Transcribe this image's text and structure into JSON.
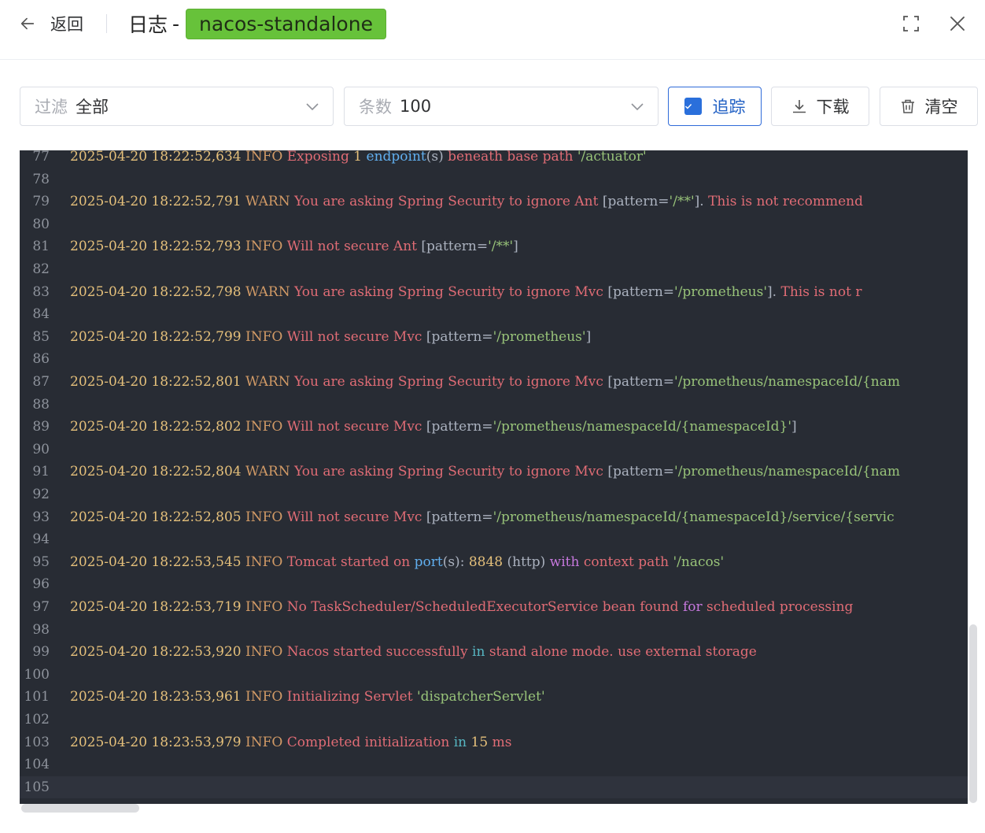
{
  "header": {
    "back_label": "返回",
    "title": "日志",
    "title_dash": "-",
    "app_tag": "nacos-standalone"
  },
  "toolbar": {
    "filter": {
      "prefix": "过滤",
      "value": "全部"
    },
    "count": {
      "prefix": "条数",
      "value": "100"
    },
    "track_label": "追踪",
    "download_label": "下载",
    "clear_label": "清空"
  },
  "colors": {
    "tag": "#67c23a",
    "accent": "#2a6fdb",
    "log_bg": "#282c34"
  },
  "log": {
    "lines": [
      {
        "n": "77",
        "segs": [
          [
            "ts",
            "2025-04-20 18:22:52,634 "
          ],
          [
            "lv",
            "INFO "
          ],
          [
            "w",
            "Exposing "
          ],
          [
            "num",
            "1 "
          ],
          [
            "kw",
            "endpoint"
          ],
          [
            "pun",
            "(s) "
          ],
          [
            "w",
            "beneath base path "
          ],
          [
            "str",
            "'/actuator'"
          ]
        ]
      },
      {
        "n": "78",
        "segs": []
      },
      {
        "n": "79",
        "segs": [
          [
            "ts",
            "2025-04-20 18:22:52,791 "
          ],
          [
            "lv",
            "WARN "
          ],
          [
            "w",
            "You are asking Spring Security to ignore Ant "
          ],
          [
            "pun",
            "[pattern="
          ],
          [
            "str",
            "'/**'"
          ],
          [
            "pun",
            "]. "
          ],
          [
            "w",
            "This is not recommend"
          ]
        ]
      },
      {
        "n": "80",
        "segs": []
      },
      {
        "n": "81",
        "segs": [
          [
            "ts",
            "2025-04-20 18:22:52,793 "
          ],
          [
            "lv",
            "INFO "
          ],
          [
            "w",
            "Will not secure Ant "
          ],
          [
            "pun",
            "[pattern="
          ],
          [
            "str",
            "'/**'"
          ],
          [
            "pun",
            "]"
          ]
        ]
      },
      {
        "n": "82",
        "segs": []
      },
      {
        "n": "83",
        "segs": [
          [
            "ts",
            "2025-04-20 18:22:52,798 "
          ],
          [
            "lv",
            "WARN "
          ],
          [
            "w",
            "You are asking Spring Security to ignore Mvc "
          ],
          [
            "pun",
            "[pattern="
          ],
          [
            "str",
            "'/prometheus'"
          ],
          [
            "pun",
            "]. "
          ],
          [
            "w",
            "This is not r"
          ]
        ]
      },
      {
        "n": "84",
        "segs": []
      },
      {
        "n": "85",
        "segs": [
          [
            "ts",
            "2025-04-20 18:22:52,799 "
          ],
          [
            "lv",
            "INFO "
          ],
          [
            "w",
            "Will not secure Mvc "
          ],
          [
            "pun",
            "[pattern="
          ],
          [
            "str",
            "'/prometheus'"
          ],
          [
            "pun",
            "]"
          ]
        ]
      },
      {
        "n": "86",
        "segs": []
      },
      {
        "n": "87",
        "segs": [
          [
            "ts",
            "2025-04-20 18:22:52,801 "
          ],
          [
            "lv",
            "WARN "
          ],
          [
            "w",
            "You are asking Spring Security to ignore Mvc "
          ],
          [
            "pun",
            "[pattern="
          ],
          [
            "str",
            "'/prometheus/namespaceId/{nam"
          ]
        ]
      },
      {
        "n": "88",
        "segs": []
      },
      {
        "n": "89",
        "segs": [
          [
            "ts",
            "2025-04-20 18:22:52,802 "
          ],
          [
            "lv",
            "INFO "
          ],
          [
            "w",
            "Will not secure Mvc "
          ],
          [
            "pun",
            "[pattern="
          ],
          [
            "str",
            "'/prometheus/namespaceId/{namespaceId}'"
          ],
          [
            "pun",
            "]"
          ]
        ]
      },
      {
        "n": "90",
        "segs": []
      },
      {
        "n": "91",
        "segs": [
          [
            "ts",
            "2025-04-20 18:22:52,804 "
          ],
          [
            "lv",
            "WARN "
          ],
          [
            "w",
            "You are asking Spring Security to ignore Mvc "
          ],
          [
            "pun",
            "[pattern="
          ],
          [
            "str",
            "'/prometheus/namespaceId/{nam"
          ]
        ]
      },
      {
        "n": "92",
        "segs": []
      },
      {
        "n": "93",
        "segs": [
          [
            "ts",
            "2025-04-20 18:22:52,805 "
          ],
          [
            "lv",
            "INFO "
          ],
          [
            "w",
            "Will not secure Mvc "
          ],
          [
            "pun",
            "[pattern="
          ],
          [
            "str",
            "'/prometheus/namespaceId/{namespaceId}/service/{servic"
          ]
        ]
      },
      {
        "n": "94",
        "segs": []
      },
      {
        "n": "95",
        "segs": [
          [
            "ts",
            "2025-04-20 18:22:53,545 "
          ],
          [
            "lv",
            "INFO "
          ],
          [
            "w",
            "Tomcat started on "
          ],
          [
            "kw",
            "port"
          ],
          [
            "pun",
            "(s): "
          ],
          [
            "num",
            "8848 "
          ],
          [
            "pun",
            "(http) "
          ],
          [
            "fn",
            "with "
          ],
          [
            "w",
            "context path "
          ],
          [
            "str",
            "'/nacos'"
          ]
        ]
      },
      {
        "n": "96",
        "segs": []
      },
      {
        "n": "97",
        "segs": [
          [
            "ts",
            "2025-04-20 18:22:53,719 "
          ],
          [
            "lv",
            "INFO "
          ],
          [
            "w",
            "No TaskScheduler/ScheduledExecutorService bean found "
          ],
          [
            "fn",
            "for "
          ],
          [
            "w",
            "scheduled processing"
          ]
        ]
      },
      {
        "n": "98",
        "segs": []
      },
      {
        "n": "99",
        "segs": [
          [
            "ts",
            "2025-04-20 18:22:53,920 "
          ],
          [
            "lv",
            "INFO "
          ],
          [
            "w",
            "Nacos started successfully "
          ],
          [
            "op",
            "in "
          ],
          [
            "w",
            "stand alone mode. use external storage"
          ]
        ]
      },
      {
        "n": "100",
        "segs": []
      },
      {
        "n": "101",
        "segs": [
          [
            "ts",
            "2025-04-20 18:23:53,961 "
          ],
          [
            "lv",
            "INFO "
          ],
          [
            "w",
            "Initializing Servlet "
          ],
          [
            "str",
            "'dispatcherServlet'"
          ]
        ]
      },
      {
        "n": "102",
        "segs": []
      },
      {
        "n": "103",
        "segs": [
          [
            "ts",
            "2025-04-20 18:23:53,979 "
          ],
          [
            "lv",
            "INFO "
          ],
          [
            "w",
            "Completed initialization "
          ],
          [
            "op",
            "in "
          ],
          [
            "num",
            "15 "
          ],
          [
            "w",
            "ms"
          ]
        ]
      },
      {
        "n": "104",
        "segs": []
      },
      {
        "n": "105",
        "segs": [],
        "active": true
      }
    ]
  }
}
